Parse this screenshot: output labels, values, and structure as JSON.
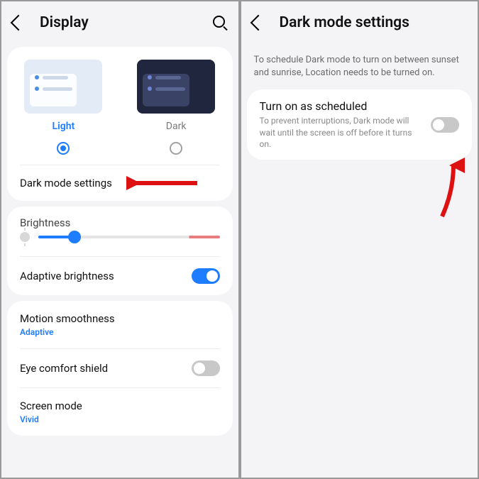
{
  "left": {
    "header": {
      "title": "Display"
    },
    "themes": {
      "light_label": "Light",
      "dark_label": "Dark",
      "selected": "light"
    },
    "dark_mode_settings": "Dark mode settings",
    "brightness": {
      "label": "Brightness",
      "value_percent": 20
    },
    "adaptive_brightness": {
      "label": "Adaptive brightness",
      "on": true
    },
    "motion_smoothness": {
      "label": "Motion smoothness",
      "value": "Adaptive"
    },
    "eye_comfort": {
      "label": "Eye comfort shield",
      "on": false
    },
    "screen_mode": {
      "label": "Screen mode",
      "value": "Vivid"
    }
  },
  "right": {
    "header": {
      "title": "Dark mode settings"
    },
    "description": "To schedule Dark mode to turn on between sunset and sunrise, Location needs to be turned on.",
    "scheduled": {
      "title": "Turn on as scheduled",
      "subtitle": "To prevent interruptions, Dark mode will wait until the screen is off before it turns on.",
      "on": false
    }
  }
}
